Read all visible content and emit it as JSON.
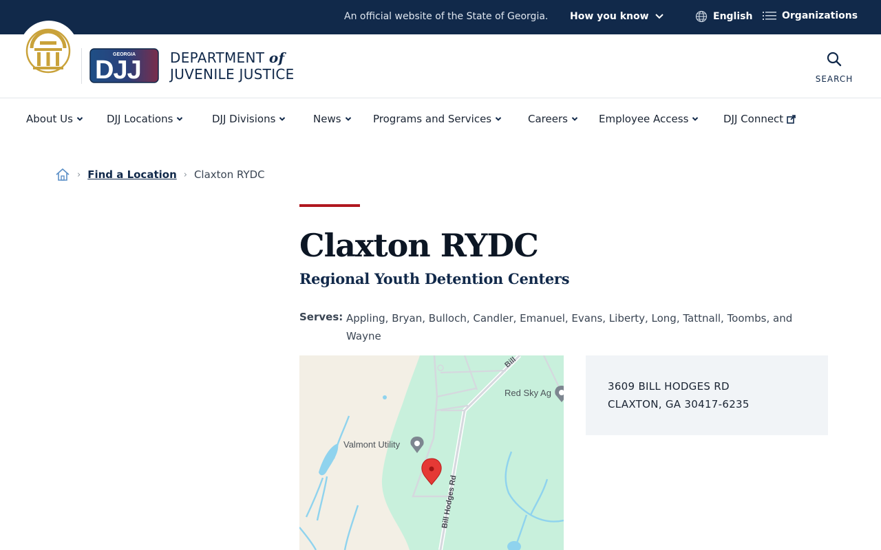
{
  "topbar": {
    "official_text": "An official website of the State of Georgia.",
    "how_you_know": "How you know",
    "language": "English",
    "organizations": "Organizations"
  },
  "header": {
    "logo_badge_text": "GEORGIA",
    "logo_text": "DJJ",
    "dept_line1_a": "DEPARTMENT",
    "dept_line1_b": "of",
    "dept_line2": "JUVENILE JUSTICE",
    "search_label": "SEARCH"
  },
  "nav": {
    "items": [
      {
        "label": "About Us"
      },
      {
        "label": "DJJ Locations"
      },
      {
        "label": "DJJ Divisions"
      },
      {
        "label": "News"
      },
      {
        "label": "Programs and Services"
      },
      {
        "label": "Careers"
      },
      {
        "label": "Employee Access"
      },
      {
        "label": "DJJ Connect"
      }
    ]
  },
  "breadcrumb": {
    "parent": "Find a Location",
    "current": "Claxton RYDC"
  },
  "page": {
    "title": "Claxton RYDC",
    "subtitle": "Regional Youth Detention Centers",
    "serves_label": "Serves:",
    "serves_value": "Appling, Bryan, Bulloch, Candler, Emanuel, Evans, Liberty, Long, Tattnall, Toombs, and Wayne"
  },
  "map": {
    "labels": {
      "road_top": "Bill",
      "poi_red_sky": "Red Sky Ag",
      "poi_valmont": "Valmont Utility",
      "road_main": "Bill Hodges Rd"
    }
  },
  "address": {
    "line1": "3609 BILL HODGES RD",
    "line2": "CLAXTON, GA 30417-6235"
  },
  "colors": {
    "navy": "#11294a",
    "accent_red": "#b0171f",
    "seal_gold": "#c9a23a",
    "map_green": "#c8f0dc",
    "map_land": "#f3efe5",
    "map_water": "#8fd3ee",
    "address_bg": "#f1f4f7"
  }
}
